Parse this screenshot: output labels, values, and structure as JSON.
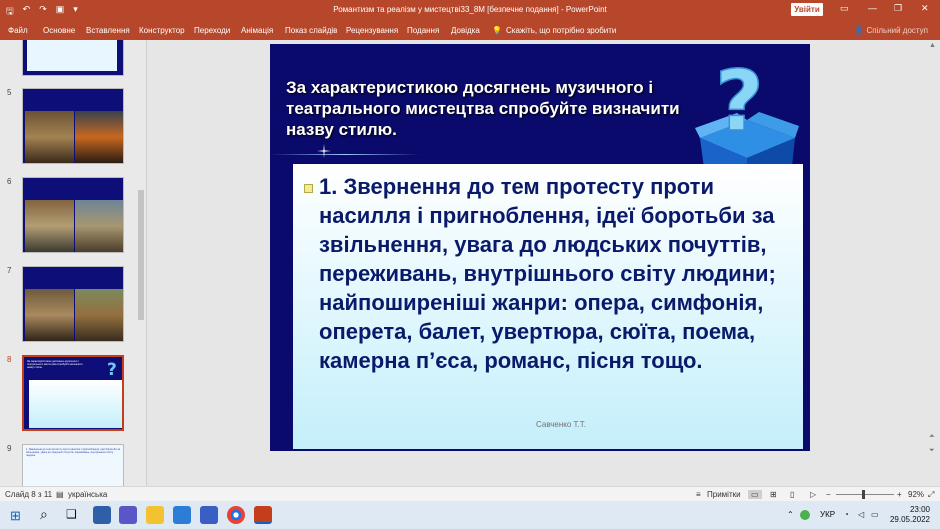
{
  "window": {
    "title": "Романтизм та реалізм у мистецтві33_8М [безпечне подання] - PowerPoint",
    "signin_label": "Увійти"
  },
  "ribbon": {
    "tabs": [
      "Файл",
      "Основне",
      "Вставлення",
      "Конструктор",
      "Переходи",
      "Анімація",
      "Показ слайдів",
      "Рецензування",
      "Подання",
      "Довідка"
    ],
    "tell_me": "Скажіть, що потрібно зробити",
    "share": "Спільний доступ"
  },
  "thumbnails": {
    "numbers": [
      "5",
      "6",
      "7",
      "8",
      "9"
    ],
    "slide9_text": "1. Звернення до тем протесту проти насилля і пригноблення, ідеї боротьби за звільнення, увага до людських почуттів, переживань, внутрішнього світу людини"
  },
  "slide": {
    "title": "За характеристикою досягнень музичного і театрального мистецтва спробуйте визначити назву стилю.",
    "body": "1. Звернення до тем протесту проти насилля і пригноблення, ідеї боротьби за звільнення, увага до людських почуттів, переживань, внутрішнього світу людини; найпоширеніші жанри: опера, симфонія, оперета, балет, увертюра, сюїта, поема, камерна п’єса, романс, пісня тощо.",
    "author": "Савченко Т.Т."
  },
  "status": {
    "slide_counter": "Слайд 8 з 11",
    "language": "українська",
    "notes": "Примітки",
    "zoom": "92%"
  },
  "taskbar": {
    "language": "УКР",
    "time": "23:00",
    "date": "29.05.2022"
  },
  "colors": {
    "accent": "#b7472a",
    "slide_bg": "#0a0a6c",
    "body_text": "#0a1a6a"
  }
}
